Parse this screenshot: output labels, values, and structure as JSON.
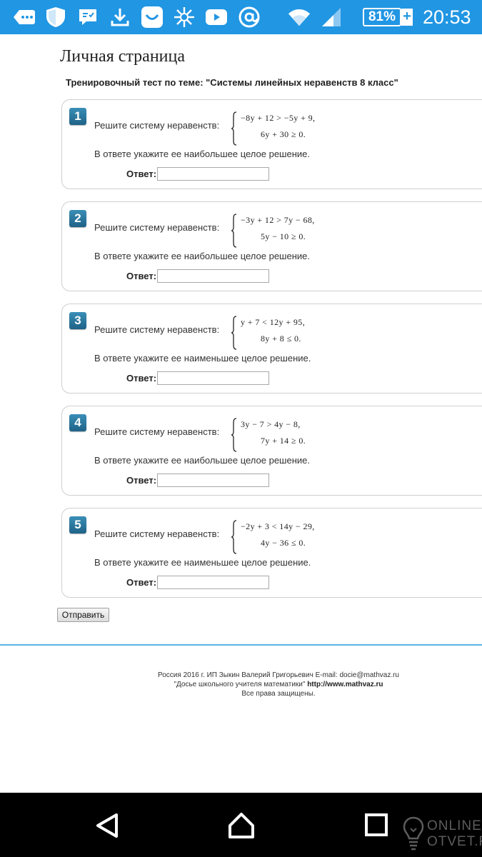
{
  "status_bar": {
    "battery": "81%",
    "battery_plus": "+",
    "time": "20:53",
    "icons": [
      "messages-icon",
      "shield-icon",
      "chat-icon",
      "download-icon",
      "smile-icon",
      "burst-icon",
      "youtube-icon",
      "at-sign-icon",
      "wifi-icon",
      "signal-icon",
      "battery-icon"
    ],
    "color": "#2196e3"
  },
  "page": {
    "title": "Личная страница",
    "subtitle": "Тренировочный тест по теме: \"Системы линейных неравенств 8 класс\""
  },
  "tasks": [
    {
      "number": "1",
      "prompt": "Решите систему неравенств:",
      "inequality_1": "−8y + 12 > −5y + 9,",
      "inequality_2": "6y + 30 ≥ 0.",
      "instruction": "В ответе укажите ее наибольшее целое решение.",
      "answer_label": "Ответ:",
      "answer_value": ""
    },
    {
      "number": "2",
      "prompt": "Решите систему неравенств:",
      "inequality_1": "−3y + 12 > 7y − 68,",
      "inequality_2": "5y − 10 ≥ 0.",
      "instruction": "В ответе укажите ее наибольшее целое решение.",
      "answer_label": "Ответ:",
      "answer_value": ""
    },
    {
      "number": "3",
      "prompt": "Решите систему неравенств:",
      "inequality_1": "y + 7 < 12y + 95,",
      "inequality_2": "8y + 8 ≤ 0.",
      "instruction": "В ответе укажите ее наименьшее целое решение.",
      "answer_label": "Ответ:",
      "answer_value": ""
    },
    {
      "number": "4",
      "prompt": "Решите систему неравенств:",
      "inequality_1": "3y − 7 > 4y − 8,",
      "inequality_2": "7y + 14 ≥ 0.",
      "instruction": "В ответе укажите ее наибольшее целое решение.",
      "answer_label": "Ответ:",
      "answer_value": ""
    },
    {
      "number": "5",
      "prompt": "Решите систему неравенств:",
      "inequality_1": "−2y + 3 < 14y − 29,",
      "inequality_2": "4y − 36 ≤ 0.",
      "instruction": "В ответе укажите ее наименьшее целое решение.",
      "answer_label": "Ответ:",
      "answer_value": ""
    }
  ],
  "submit_label": "Отправить",
  "footer": {
    "line1": "Россия 2016 г. ИП Зыкин Валерий Григорьевич E-mail: docie@mathvaz.ru",
    "line2_prefix": "\"Досье школьного учителя математики\" ",
    "line2_link": "http://www.mathvaz.ru",
    "line3": "Все права защищены."
  },
  "nav_bar": {
    "buttons": [
      "back-icon",
      "home-icon",
      "recents-icon"
    ]
  },
  "watermark": {
    "line1": "ONLINE",
    "line2": "OTVET.RU"
  }
}
